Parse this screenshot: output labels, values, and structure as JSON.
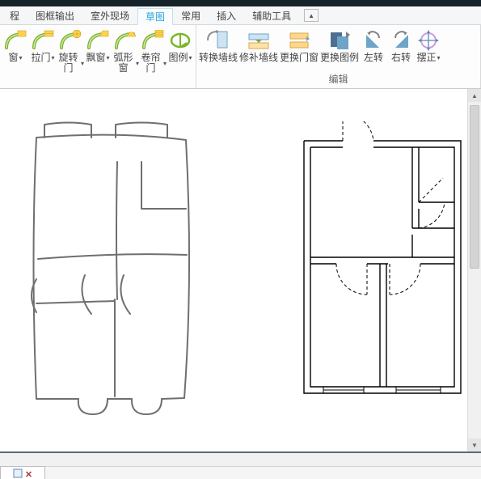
{
  "menu": {
    "items": [
      {
        "label": "程",
        "active": false
      },
      {
        "label": "图框输出",
        "active": false
      },
      {
        "label": "室外现场",
        "active": false
      },
      {
        "label": "草图",
        "active": true
      },
      {
        "label": "常用",
        "active": false
      },
      {
        "label": "插入",
        "active": false
      },
      {
        "label": "辅助工具",
        "active": false
      }
    ],
    "collapse_glyph": "▲"
  },
  "ribbon": {
    "group_draw": {
      "label": "",
      "buttons": [
        {
          "name": "win-tool",
          "label": "窗",
          "dd": true
        },
        {
          "name": "sliding-door",
          "label": "拉门",
          "dd": true
        },
        {
          "name": "revolving-door",
          "label": "旋转门",
          "dd": true
        },
        {
          "name": "bay-window",
          "label": "飘窗",
          "dd": true
        },
        {
          "name": "arc-window",
          "label": "弧形窗",
          "dd": true
        },
        {
          "name": "rolling-door",
          "label": "卷帘门",
          "dd": true
        },
        {
          "name": "legend-tool",
          "label": "图例",
          "dd": true
        }
      ]
    },
    "group_edit": {
      "label": "编辑",
      "buttons": [
        {
          "name": "convert-wall",
          "label": "转换墙线"
        },
        {
          "name": "repair-wall",
          "label": "修补墙线"
        },
        {
          "name": "replace-door-win",
          "label": "更换门窗"
        },
        {
          "name": "replace-legend",
          "label": "更换图例"
        },
        {
          "name": "rotate-left",
          "label": "左转"
        },
        {
          "name": "rotate-right",
          "label": "右转"
        },
        {
          "name": "align-tool",
          "label": "摆正",
          "dd": true
        }
      ]
    }
  },
  "panel": {
    "tab_glyph": "✕"
  },
  "icons": {
    "green": "#78b128",
    "edge": "#3a84c2"
  }
}
